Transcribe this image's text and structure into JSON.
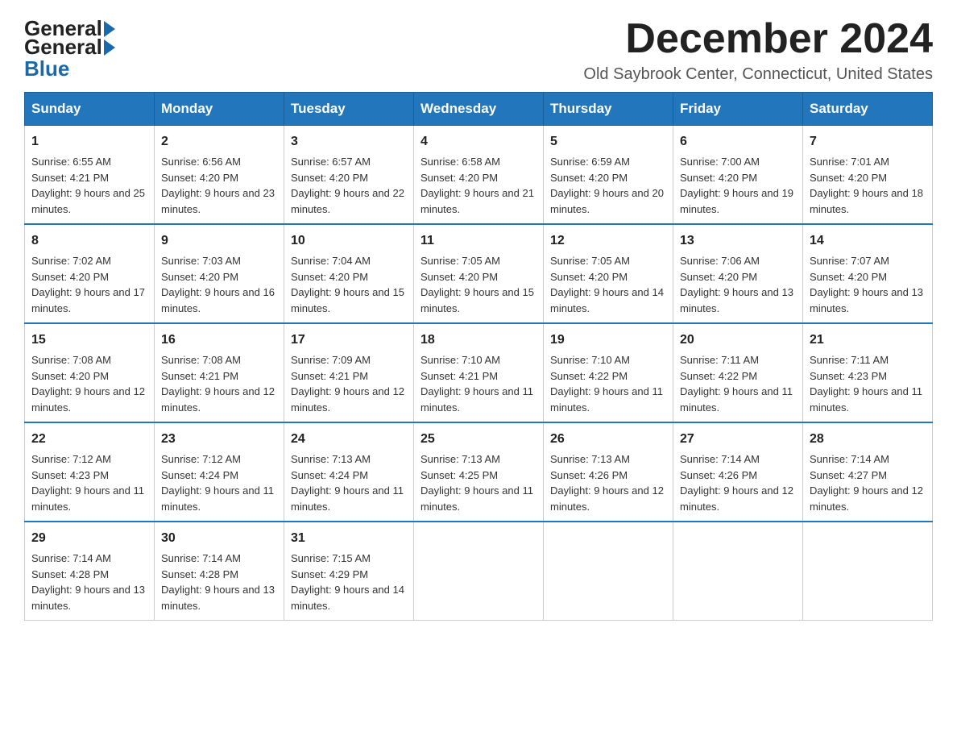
{
  "header": {
    "logo": {
      "general": "General",
      "blue": "Blue"
    },
    "title": "December 2024",
    "location": "Old Saybrook Center, Connecticut, United States"
  },
  "days_of_week": [
    "Sunday",
    "Monday",
    "Tuesday",
    "Wednesday",
    "Thursday",
    "Friday",
    "Saturday"
  ],
  "weeks": [
    [
      {
        "day": "1",
        "sunrise": "Sunrise: 6:55 AM",
        "sunset": "Sunset: 4:21 PM",
        "daylight": "Daylight: 9 hours and 25 minutes."
      },
      {
        "day": "2",
        "sunrise": "Sunrise: 6:56 AM",
        "sunset": "Sunset: 4:20 PM",
        "daylight": "Daylight: 9 hours and 23 minutes."
      },
      {
        "day": "3",
        "sunrise": "Sunrise: 6:57 AM",
        "sunset": "Sunset: 4:20 PM",
        "daylight": "Daylight: 9 hours and 22 minutes."
      },
      {
        "day": "4",
        "sunrise": "Sunrise: 6:58 AM",
        "sunset": "Sunset: 4:20 PM",
        "daylight": "Daylight: 9 hours and 21 minutes."
      },
      {
        "day": "5",
        "sunrise": "Sunrise: 6:59 AM",
        "sunset": "Sunset: 4:20 PM",
        "daylight": "Daylight: 9 hours and 20 minutes."
      },
      {
        "day": "6",
        "sunrise": "Sunrise: 7:00 AM",
        "sunset": "Sunset: 4:20 PM",
        "daylight": "Daylight: 9 hours and 19 minutes."
      },
      {
        "day": "7",
        "sunrise": "Sunrise: 7:01 AM",
        "sunset": "Sunset: 4:20 PM",
        "daylight": "Daylight: 9 hours and 18 minutes."
      }
    ],
    [
      {
        "day": "8",
        "sunrise": "Sunrise: 7:02 AM",
        "sunset": "Sunset: 4:20 PM",
        "daylight": "Daylight: 9 hours and 17 minutes."
      },
      {
        "day": "9",
        "sunrise": "Sunrise: 7:03 AM",
        "sunset": "Sunset: 4:20 PM",
        "daylight": "Daylight: 9 hours and 16 minutes."
      },
      {
        "day": "10",
        "sunrise": "Sunrise: 7:04 AM",
        "sunset": "Sunset: 4:20 PM",
        "daylight": "Daylight: 9 hours and 15 minutes."
      },
      {
        "day": "11",
        "sunrise": "Sunrise: 7:05 AM",
        "sunset": "Sunset: 4:20 PM",
        "daylight": "Daylight: 9 hours and 15 minutes."
      },
      {
        "day": "12",
        "sunrise": "Sunrise: 7:05 AM",
        "sunset": "Sunset: 4:20 PM",
        "daylight": "Daylight: 9 hours and 14 minutes."
      },
      {
        "day": "13",
        "sunrise": "Sunrise: 7:06 AM",
        "sunset": "Sunset: 4:20 PM",
        "daylight": "Daylight: 9 hours and 13 minutes."
      },
      {
        "day": "14",
        "sunrise": "Sunrise: 7:07 AM",
        "sunset": "Sunset: 4:20 PM",
        "daylight": "Daylight: 9 hours and 13 minutes."
      }
    ],
    [
      {
        "day": "15",
        "sunrise": "Sunrise: 7:08 AM",
        "sunset": "Sunset: 4:20 PM",
        "daylight": "Daylight: 9 hours and 12 minutes."
      },
      {
        "day": "16",
        "sunrise": "Sunrise: 7:08 AM",
        "sunset": "Sunset: 4:21 PM",
        "daylight": "Daylight: 9 hours and 12 minutes."
      },
      {
        "day": "17",
        "sunrise": "Sunrise: 7:09 AM",
        "sunset": "Sunset: 4:21 PM",
        "daylight": "Daylight: 9 hours and 12 minutes."
      },
      {
        "day": "18",
        "sunrise": "Sunrise: 7:10 AM",
        "sunset": "Sunset: 4:21 PM",
        "daylight": "Daylight: 9 hours and 11 minutes."
      },
      {
        "day": "19",
        "sunrise": "Sunrise: 7:10 AM",
        "sunset": "Sunset: 4:22 PM",
        "daylight": "Daylight: 9 hours and 11 minutes."
      },
      {
        "day": "20",
        "sunrise": "Sunrise: 7:11 AM",
        "sunset": "Sunset: 4:22 PM",
        "daylight": "Daylight: 9 hours and 11 minutes."
      },
      {
        "day": "21",
        "sunrise": "Sunrise: 7:11 AM",
        "sunset": "Sunset: 4:23 PM",
        "daylight": "Daylight: 9 hours and 11 minutes."
      }
    ],
    [
      {
        "day": "22",
        "sunrise": "Sunrise: 7:12 AM",
        "sunset": "Sunset: 4:23 PM",
        "daylight": "Daylight: 9 hours and 11 minutes."
      },
      {
        "day": "23",
        "sunrise": "Sunrise: 7:12 AM",
        "sunset": "Sunset: 4:24 PM",
        "daylight": "Daylight: 9 hours and 11 minutes."
      },
      {
        "day": "24",
        "sunrise": "Sunrise: 7:13 AM",
        "sunset": "Sunset: 4:24 PM",
        "daylight": "Daylight: 9 hours and 11 minutes."
      },
      {
        "day": "25",
        "sunrise": "Sunrise: 7:13 AM",
        "sunset": "Sunset: 4:25 PM",
        "daylight": "Daylight: 9 hours and 11 minutes."
      },
      {
        "day": "26",
        "sunrise": "Sunrise: 7:13 AM",
        "sunset": "Sunset: 4:26 PM",
        "daylight": "Daylight: 9 hours and 12 minutes."
      },
      {
        "day": "27",
        "sunrise": "Sunrise: 7:14 AM",
        "sunset": "Sunset: 4:26 PM",
        "daylight": "Daylight: 9 hours and 12 minutes."
      },
      {
        "day": "28",
        "sunrise": "Sunrise: 7:14 AM",
        "sunset": "Sunset: 4:27 PM",
        "daylight": "Daylight: 9 hours and 12 minutes."
      }
    ],
    [
      {
        "day": "29",
        "sunrise": "Sunrise: 7:14 AM",
        "sunset": "Sunset: 4:28 PM",
        "daylight": "Daylight: 9 hours and 13 minutes."
      },
      {
        "day": "30",
        "sunrise": "Sunrise: 7:14 AM",
        "sunset": "Sunset: 4:28 PM",
        "daylight": "Daylight: 9 hours and 13 minutes."
      },
      {
        "day": "31",
        "sunrise": "Sunrise: 7:15 AM",
        "sunset": "Sunset: 4:29 PM",
        "daylight": "Daylight: 9 hours and 14 minutes."
      },
      null,
      null,
      null,
      null
    ]
  ]
}
